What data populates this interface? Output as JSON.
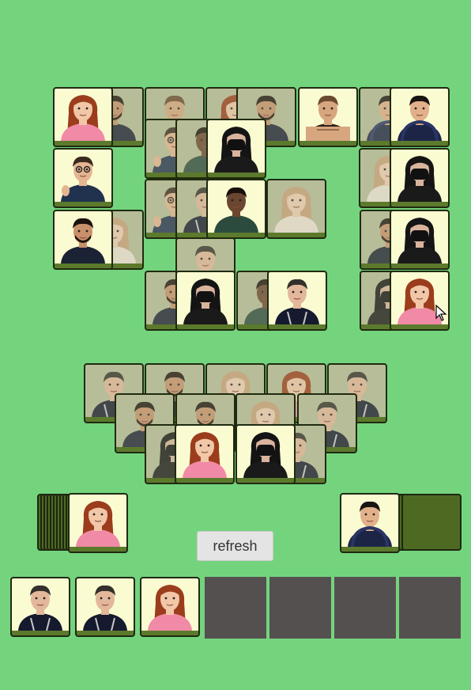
{
  "refresh_label": "refresh",
  "characters": {
    "A": {
      "name": "redhead-woman",
      "skin": "#f1c7a8",
      "hair": "#9b3d1c",
      "cloth": "#f08aa6"
    },
    "B": {
      "name": "masked-woman",
      "skin": "#d9b49c",
      "hair": "#141414",
      "cloth": "#1a1a1a"
    },
    "C": {
      "name": "glasses-man-thumbs-up",
      "skin": "#e5b592",
      "hair": "#3a2a20",
      "cloth": "#20324e"
    },
    "D": {
      "name": "bearded-man",
      "skin": "#c8916b",
      "hair": "#1c130f",
      "cloth": "#1b2233"
    },
    "E": {
      "name": "hoodie-man-smiling",
      "skin": "#e2b08a",
      "hair": "#191512",
      "cloth": "#1d2546"
    },
    "F": {
      "name": "muscular-man",
      "skin": "#d7a67f",
      "hair": "#6a4a2f",
      "cloth": "#2f241b"
    },
    "G": {
      "name": "dark-skinned-man",
      "skin": "#6b4630",
      "hair": "#1a100b",
      "cloth": "#2c4b3e"
    },
    "H": {
      "name": "suspenders-man",
      "skin": "#e3b89a",
      "hair": "#34302c",
      "cloth": "#161a2e"
    },
    "I": {
      "name": "blonde-woman",
      "skin": "#f0cdb4",
      "hair": "#caa17a",
      "cloth": "#ede3d7"
    }
  },
  "upper_pyramid": [
    {
      "c": "D",
      "dim": true
    },
    {
      "c": "F",
      "dim": true
    },
    {
      "c": "A",
      "dim": true
    },
    {
      "c": "D",
      "dim": true
    },
    {
      "c": "E",
      "dim": true
    },
    {
      "c": "A",
      "dim": false
    },
    {
      "c": "C",
      "dim": true
    },
    {
      "c": "F",
      "dim": false
    },
    {
      "c": "E",
      "dim": false
    },
    {
      "c": "C",
      "dim": true
    },
    {
      "c": "G",
      "dim": true
    },
    {
      "c": "B",
      "dim": false
    },
    {
      "c": "I",
      "dim": true
    },
    {
      "c": "B",
      "dim": false
    },
    {
      "c": "C",
      "dim": false
    },
    {
      "c": "H",
      "dim": true
    },
    {
      "c": "G",
      "dim": false
    },
    {
      "c": "I",
      "dim": true
    },
    {
      "c": "D",
      "dim": true
    },
    {
      "c": "D",
      "dim": false
    },
    {
      "c": "I",
      "dim": true
    },
    {
      "c": "D",
      "dim": true
    },
    {
      "c": "B",
      "dim": false
    },
    {
      "c": "H",
      "dim": true
    },
    {
      "c": "B",
      "dim": false
    },
    {
      "c": "G",
      "dim": true
    },
    {
      "c": "H",
      "dim": false
    },
    {
      "c": "B",
      "dim": true
    },
    {
      "c": "A",
      "dim": false
    }
  ],
  "lower_pyramid": [
    {
      "c": "H",
      "dim": true
    },
    {
      "c": "D",
      "dim": true
    },
    {
      "c": "I",
      "dim": true
    },
    {
      "c": "A",
      "dim": true
    },
    {
      "c": "H",
      "dim": true
    },
    {
      "c": "D",
      "dim": true
    },
    {
      "c": "D",
      "dim": true
    },
    {
      "c": "I",
      "dim": true
    },
    {
      "c": "H",
      "dim": true
    },
    {
      "c": "B",
      "dim": true
    },
    {
      "c": "A",
      "dim": false
    },
    {
      "c": "B",
      "dim": false
    },
    {
      "c": "H",
      "dim": true
    }
  ],
  "left_stack_top": "A",
  "right_stack_top": "E",
  "tray": [
    "H",
    "H",
    "A",
    null,
    null,
    null,
    null
  ]
}
